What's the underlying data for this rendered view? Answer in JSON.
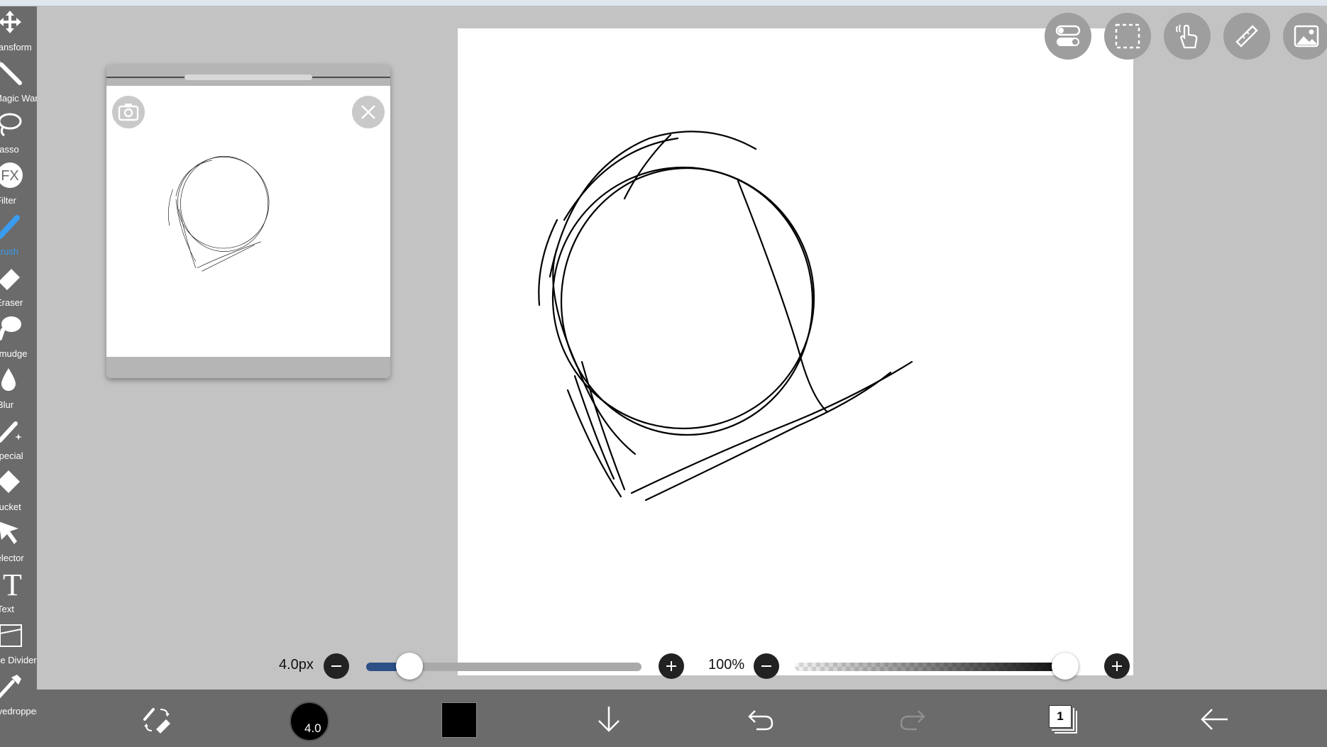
{
  "window_title": "",
  "tools": [
    {
      "label": "Transform",
      "icon": "transform-icon"
    },
    {
      "label": "Magic Wand",
      "icon": "magic-wand-icon"
    },
    {
      "label": "Lasso",
      "icon": "lasso-icon"
    },
    {
      "label": "Filter",
      "icon": "fx-icon"
    },
    {
      "label": "Brush",
      "icon": "brush-icon",
      "active": true
    },
    {
      "label": "Eraser",
      "icon": "eraser-icon"
    },
    {
      "label": "Smudge",
      "icon": "smudge-icon"
    },
    {
      "label": "Blur",
      "icon": "blur-drop-icon"
    },
    {
      "label": "Special",
      "icon": "special-sparkle-icon"
    },
    {
      "label": "Bucket",
      "icon": "bucket-icon"
    },
    {
      "label": "Selector",
      "icon": "selector-arrow-icon"
    },
    {
      "label": "Text",
      "icon": "text-icon"
    },
    {
      "label": "Frame Divider",
      "icon": "frame-divider-icon"
    },
    {
      "label": "Eyedropper",
      "icon": "eyedropper-icon"
    }
  ],
  "colors": {
    "toolbar_bg": "#6b6b6b",
    "workspace_bg": "#c3c3c3",
    "active_tool": "#3a9bf0",
    "slider_fill": "#2c4f86"
  },
  "top_buttons": [
    {
      "name": "toggle-settings-icon"
    },
    {
      "name": "selection-icon"
    },
    {
      "name": "hand-touch-icon"
    },
    {
      "name": "ruler-icon"
    },
    {
      "name": "material-image-icon"
    }
  ],
  "reference_window": {
    "camera_icon": "camera-icon",
    "close_icon": "close-icon"
  },
  "brush": {
    "size_text": "4.0px",
    "size_fraction": 0.12,
    "size_badge": "4.0"
  },
  "opacity": {
    "text": "100%",
    "fraction": 1.0
  },
  "bottom_bar": {
    "items": [
      "brush-eraser-swap-icon",
      "brush-size-button",
      "color-swatch",
      "save-down-icon",
      "undo-icon",
      "redo-icon",
      "layers-button",
      "back-icon"
    ],
    "layer_count": "1",
    "color": "#000000"
  }
}
